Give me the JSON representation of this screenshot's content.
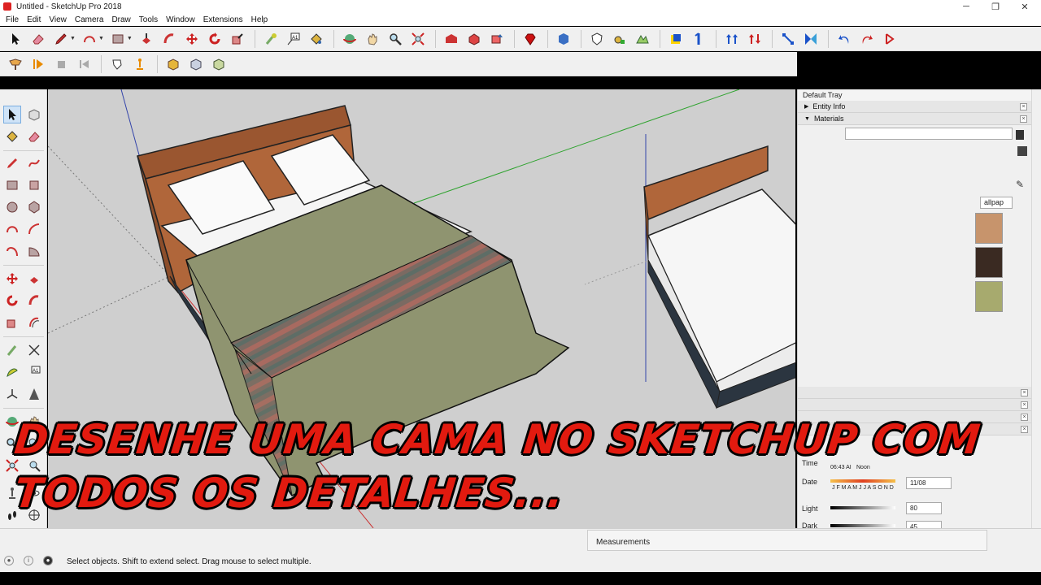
{
  "window": {
    "title": "Untitled - SketchUp Pro 2018",
    "minimize": "─",
    "maximize": "❐",
    "close": "✕"
  },
  "menu": [
    "File",
    "Edit",
    "View",
    "Camera",
    "Draw",
    "Tools",
    "Window",
    "Extensions",
    "Help"
  ],
  "tray": {
    "title": "Default Tray",
    "entity_info": "Entity Info",
    "materials": "Materials",
    "texture_dropdown": "allpap",
    "time_label": "Time",
    "time_value": "06:43 AI",
    "noon_label": "Noon",
    "date_label": "Date",
    "months": "J F M A M J J A S O N D",
    "date_value": "11/08",
    "light_label": "Light",
    "light_value": "80",
    "dark_label": "Dark",
    "dark_value": "45"
  },
  "overlay": {
    "line1": "DESENHE UMA CAMA NO SKETCHUP COM",
    "line2": "TODOS OS DETALHES..."
  },
  "measurements_label": "Measurements",
  "status": "Select objects. Shift to extend select. Drag mouse to select multiple.",
  "colors": {
    "headboard": "#b0663a",
    "blanket": "#8f9470",
    "mattress": "#f5f5f5",
    "base": "#2b3540",
    "overlay_text": "#e21a0f",
    "axis_green": "#2fa32f",
    "axis_red": "#c33",
    "axis_blue": "#3344aa"
  }
}
